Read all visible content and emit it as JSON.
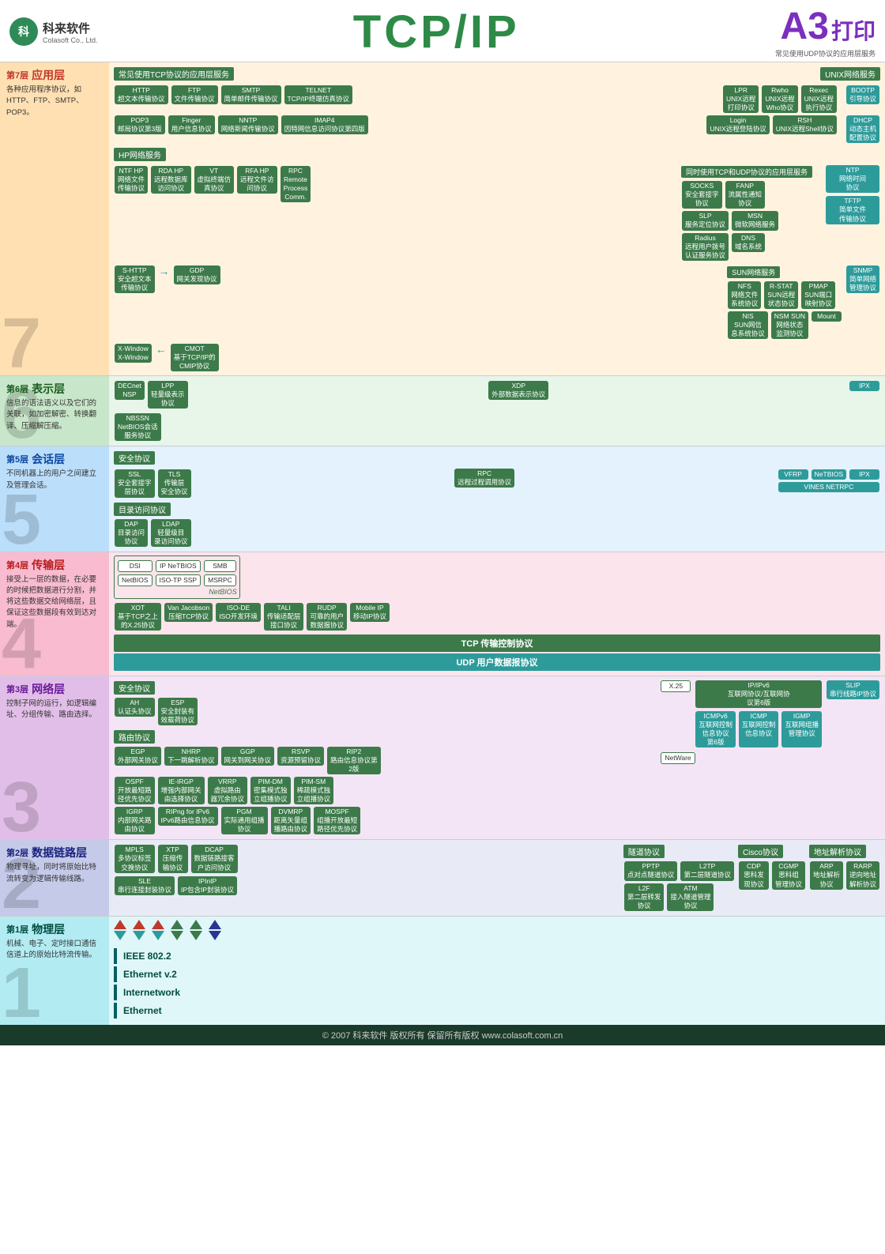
{
  "header": {
    "logo_cn": "科来软件",
    "logo_en": "Colasoft Co., Ltd.",
    "title": "TCP/IP",
    "a3": "A3",
    "print": "打印",
    "a3_sub": "常见使用UDP协议的应用层服务"
  },
  "layers": [
    {
      "num": "7",
      "word": "第7层",
      "name": "应用层",
      "desc": "各种应用程序协议，如HTTP、FTP、SMTP、POP3。"
    },
    {
      "num": "6",
      "word": "第6层",
      "name": "表示层",
      "desc": "信息的语法语义以及它们的关联，如加密解密、转换翻译、压缩解压缩。"
    },
    {
      "num": "5",
      "word": "第5层",
      "name": "会话层",
      "desc": "不同机器上的用户之间建立及管理会话。"
    },
    {
      "num": "4",
      "word": "第4层",
      "name": "传输层",
      "desc": "接受上一层的数据，在必要的时候把数据进行分割，并将这些数据交给网络层，且保证这些数据段有效到达对端。"
    },
    {
      "num": "3",
      "word": "第3层",
      "name": "网络层",
      "desc": "控制子网的运行，如逻辑编址、分组传输、路由选择。"
    },
    {
      "num": "2",
      "word": "第2层",
      "name": "数据链路层",
      "desc": "物理寻址，同时将原始比特流转变为逻辑传输线路。"
    },
    {
      "num": "1",
      "word": "第1层",
      "name": "物理层",
      "desc": "机械、电子、定时接口通信信道上的原始比特流传输。"
    }
  ],
  "footer": {
    "copyright": "© 2007   科来软件  版权所有   保留所有版权   www.colasoft.com.cn"
  },
  "layer7": {
    "top_header": "常见使用TCP协议的应用层服务",
    "unix_header": "UNIX网络服务",
    "right_header": "常见使用UDP协议的应用层服务",
    "protos_row1": [
      {
        "name": "HTTP\n超文本传输协议"
      },
      {
        "name": "FTP\n文件传输协议"
      },
      {
        "name": "SMTP\n简单邮件传输协议"
      },
      {
        "name": "TELNET\nTCP/IP终端仿真协议"
      }
    ],
    "unix_row1": [
      {
        "name": "LPR\nUNIX远程\n打印协议"
      },
      {
        "name": "Rwho\nUNIX远程\nWho协议"
      },
      {
        "name": "Rexec\nUNIX远程\n执行协议"
      }
    ],
    "right_row1": [
      {
        "name": "BOOTP\n引导协议"
      }
    ],
    "protos_row2": [
      {
        "name": "POP3\n邮局协议第3版"
      },
      {
        "name": "Finger\n用户信息协议"
      },
      {
        "name": "NNTP\n网络新闻传输协议"
      },
      {
        "name": "IMAP4\n因特网信息访问协议第四版"
      }
    ],
    "unix_row2": [
      {
        "name": "Login\nUNIX远程登陆协议"
      },
      {
        "name": "RSH\nUNIX远程Shell协议"
      }
    ],
    "right_row2": [
      {
        "name": "DHCP\n动态主机\n配置协议"
      }
    ],
    "right_row3": [
      {
        "name": "NTP\n网络时间\n协议"
      }
    ],
    "right_row4": [
      {
        "name": "TFTP\n简单文件\n传输协议"
      }
    ],
    "hp_header": "HP网络服务",
    "hp_protos": [
      {
        "name": "NTF HP\n网络文件\n传输协议"
      },
      {
        "name": "RDA HP\n远程数据库\n访问协议"
      },
      {
        "name": "VT\n虚拟终端仿\n真协议"
      },
      {
        "name": "RFA HP\n远程文件访\n问协议"
      },
      {
        "name": "RPC\nRemote\nProcess\nComm."
      }
    ],
    "udp_header": "同时使用TCP和\nUDP协议的应用层服务",
    "udp_protos": [
      {
        "name": "SOCKS\n安全套接字\n协议"
      },
      {
        "name": "FANP\n流属性通知\n协议"
      }
    ],
    "udp_protos2": [
      {
        "name": "SLP\n服务定位协议"
      },
      {
        "name": "MSN\n微软网络服务"
      }
    ],
    "udp_protos3": [
      {
        "name": "Radius\n远程用户拨号\n认证服务协议"
      },
      {
        "name": "DNS\n域名系统"
      }
    ],
    "shttp": {
      "name": "S-HTTP\n安全超文本\n传输协议"
    },
    "gdp": {
      "name": "GDP\n网关发现协议"
    },
    "sun_header": "SUN网络服务",
    "sun_protos": [
      {
        "name": "NFS\n网络文件\n系统协议"
      },
      {
        "name": "R-STAT\nSUN远程\n状态协议"
      },
      {
        "name": "PMAP\nSUN端口\n映射协议"
      }
    ],
    "sun_protos2": [
      {
        "name": "NIS\nSUN网信\n息系统协议"
      },
      {
        "name": "NSM SUN\n网络状态\n监测协议"
      },
      {
        "name": "Mount"
      }
    ],
    "snmp": {
      "name": "SNMP\n简单网络\n管理协议"
    },
    "xwindow": {
      "name": "X-Window\nX-Window"
    },
    "cmot": {
      "name": "CMOT\n基于TCP/IP的\nCMIP协议"
    }
  },
  "layer6": {
    "decnet": {
      "name": "DECnet\nNSP"
    },
    "lpp": {
      "name": "LPP\n轻量级表示\n协议"
    },
    "xdp": {
      "name": "XDP\n外部数据表示协议"
    },
    "ipx": {
      "name": "IPX"
    },
    "nbssn": {
      "name": "NBSSN\nNetBIOS会话\n服务协议"
    }
  },
  "layer5": {
    "security_header": "安全协议",
    "ssl": {
      "name": "SSL\n安全套接字\n层协议"
    },
    "tls": {
      "name": "TLS\n传输层\n安全协议"
    },
    "rpc": {
      "name": "RPC\n远程过程调用协议"
    },
    "vfrp": {
      "name": "VFRP"
    },
    "netbios2": {
      "name": "NeTBIOS"
    },
    "ipx2": {
      "name": "IPX"
    },
    "vines": {
      "name": "VINES NETRPC"
    },
    "dir_header": "目录访问协议",
    "dap": {
      "name": "DAP\n目录访问\n协议"
    },
    "ldap": {
      "name": "LDAP\n轻量级目\n录访问协议"
    }
  },
  "layer4": {
    "dsi": {
      "name": "DSI"
    },
    "netbios": {
      "name": "NetBIOS"
    },
    "ip_netbios": {
      "name": "IP NeTBIOS"
    },
    "iso_tp_ssp": {
      "name": "ISO-TP SSP"
    },
    "smb": {
      "name": "SMB"
    },
    "msrpc": {
      "name": "MSRPC"
    },
    "xot": {
      "name": "XOT\n基于TCP之上\n的X.25协议"
    },
    "van_jacob": {
      "name": "Van Jacobson\n压缩TCP协议"
    },
    "iso_de": {
      "name": "ISO-DE\nISO开发环境"
    },
    "tali": {
      "name": "TALI\n传输适配层\n接口协议"
    },
    "rudp": {
      "name": "RUDP\n可靠的用户\n数据报协议"
    },
    "mobile_ip": {
      "name": "Mobile IP\n移动IP协议"
    },
    "tcp_bar": "TCP 传输控制协议",
    "udp_bar": "UDP 用户数据报协议"
  },
  "layer3": {
    "security_header": "安全协议",
    "ah": {
      "name": "AH\n认证头协议"
    },
    "esp": {
      "name": "ESP\n安全封装有\n效载荷协议"
    },
    "routing_header": "路由协议",
    "egp": {
      "name": "EGP\n外部网关协议"
    },
    "nhrp": {
      "name": "NHRP\n下一跳解析协议"
    },
    "ggp": {
      "name": "GGP\n网关到网关协议"
    },
    "rsvp": {
      "name": "RSVP\n资源预留协议"
    },
    "rip2": {
      "name": "RIP2\n路由信息协议第\n2版"
    },
    "x25": {
      "name": "X.25"
    },
    "ospf": {
      "name": "OSPF\n开放最短路\n径优先协议"
    },
    "ie_irgp": {
      "name": "IE-IRGP\n增强内部网关\n由选择协议"
    },
    "vrrp": {
      "name": "VRRP\n虚拟路由\n器冗余协议"
    },
    "pim_dm": {
      "name": "PIM-DM\n密集模式独\n立组播协议"
    },
    "pim_sm": {
      "name": "PIM-SM\n稀疏模式独\n立组播协议"
    },
    "igrp": {
      "name": "IGRP\n内部网关路\n由协议"
    },
    "ripng": {
      "name": "RIPng for IPv6\nIPv6路由信息协议"
    },
    "pgm": {
      "name": "PGM\n实际通用组播\n协议"
    },
    "dvmrp": {
      "name": "DVMRP\n距离矢量组\n播路由协议"
    },
    "mospf": {
      "name": "MOSPF\n组播开放最短\n路径优先协议"
    },
    "ip_ipv6": {
      "name": "IP/IPv6\n互联网协议/互联网协\n议第6版"
    },
    "slip": {
      "name": "SLIP\n串行线路IP协议"
    },
    "icmpv6": {
      "name": "ICMPv6\n互联网控制\n信息协议\n第6版"
    },
    "icmp": {
      "name": "ICMP\n互联网控制\n信息协议"
    },
    "igmp": {
      "name": "IGMP\n互联网组播\n管理协议"
    },
    "netware": {
      "name": "NetWare"
    }
  },
  "layer2": {
    "tunnel_header": "隧道协议",
    "cisco_header": "Cisco协议",
    "addr_header": "地址解析协议",
    "mpls": {
      "name": "MPLS\n多协议标签\n交换协议"
    },
    "xtp": {
      "name": "XTP\n压缩传\n输协议"
    },
    "dcap": {
      "name": "DCAP\n数据链路接客\n户访问协议"
    },
    "pptp": {
      "name": "PPTP\n点对点隧道协议"
    },
    "l2tp": {
      "name": "L2TP\n第二层隧道协议"
    },
    "cdp": {
      "name": "CDP\n思科发\n现协议"
    },
    "arp": {
      "name": "ARP\n地址解析\n协议"
    },
    "sle": {
      "name": "SLE\n串行连接封装协议"
    },
    "ipinip": {
      "name": "IPInIP\nIP包含IP封装协议"
    },
    "l2f": {
      "name": "L2F\n第二层转发\n协议"
    },
    "atm": {
      "name": "ATM\n接入隧道管理\n协议"
    },
    "cgmp": {
      "name": "CGMP\n思科组\n管理协议"
    },
    "rarp": {
      "name": "RARP\n逆向地址\n解析协议"
    }
  },
  "layer1": {
    "ieee": "IEEE 802.2",
    "ethernet": "Ethernet v.2",
    "internetwork": "Internetwork",
    "ethernet2": "Ethernet"
  }
}
